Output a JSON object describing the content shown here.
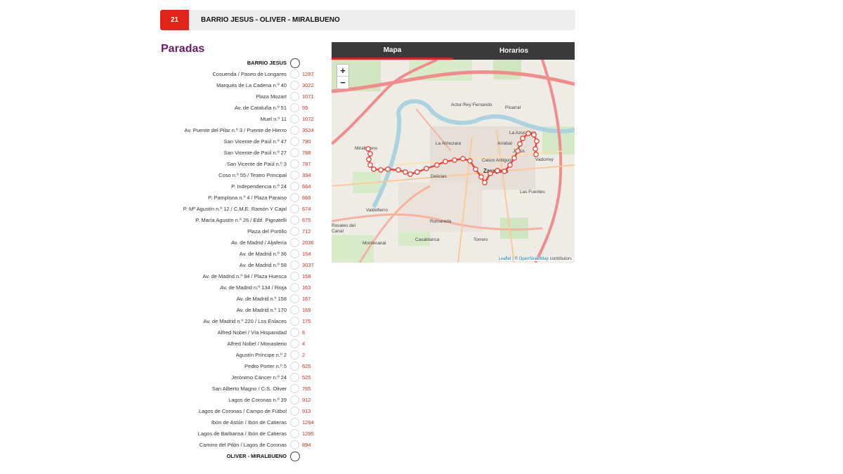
{
  "line": {
    "number": "21",
    "name": "BARRIO JESUS - OLIVER - MIRALBUENO"
  },
  "stops_title": "Paradas",
  "tabs": [
    {
      "label": "Mapa",
      "active": true
    },
    {
      "label": "Horarios",
      "active": false
    }
  ],
  "stops": [
    {
      "name": "BARRIO JESUS",
      "code": "",
      "terminal": true
    },
    {
      "name": "Cosuenda / Paseo de Longares",
      "code": "1297"
    },
    {
      "name": "Marqués de La Cadena n.º 40",
      "code": "3022"
    },
    {
      "name": "Plaza Mozart",
      "code": "1071"
    },
    {
      "name": "Av. de Cataluña n.º 51",
      "code": "55"
    },
    {
      "name": "Muel n.º 11",
      "code": "1072"
    },
    {
      "name": "Av. Puente del Pilar n.º 3 / Puente de Hierro",
      "code": "3524"
    },
    {
      "name": "San Vicente de Paúl n.º 47",
      "code": "790"
    },
    {
      "name": "San Vicente de Paúl n.º 27",
      "code": "788"
    },
    {
      "name": "San Vicente de Paúl n.º 3",
      "code": "787"
    },
    {
      "name": "Coso n.º 55 / Teatro Principal",
      "code": "334"
    },
    {
      "name": "P. Independencia n.º 24",
      "code": "664"
    },
    {
      "name": "P. Pamplona n.º 4 / Plaza Paraiso",
      "code": "669"
    },
    {
      "name": "P. Mª Agustín n.º 12 / C.M.E. Ramón Y Cajal",
      "code": "674"
    },
    {
      "name": "P. María Agustín n.º 26 / Edif. Pignatelli",
      "code": "675"
    },
    {
      "name": "Plaza del Portillo",
      "code": "712"
    },
    {
      "name": "Av. de Madrid / Aljafería",
      "code": "2036"
    },
    {
      "name": "Av. de Madrid n.º 36",
      "code": "154"
    },
    {
      "name": "Av. de Madrid n.º 58",
      "code": "3037"
    },
    {
      "name": "Av. de Madrid n.º 94 / Plaza Huesca",
      "code": "158"
    },
    {
      "name": "Av. de Madrid n.º 134 / Rioja",
      "code": "163"
    },
    {
      "name": "Av. de Madrid n.º 158",
      "code": "167"
    },
    {
      "name": "Av. de Madrid n.º 170",
      "code": "169"
    },
    {
      "name": "Av. de Madrid n.º 220 / Los Enlaces",
      "code": "175"
    },
    {
      "name": "Alfred Nobel / Vía Hispanidad",
      "code": "6"
    },
    {
      "name": "Alfred Nobel / Monasterio",
      "code": "4"
    },
    {
      "name": "Agustín Príncipe n.º 2",
      "code": "2"
    },
    {
      "name": "Pedro Porter n.º 5",
      "code": "625"
    },
    {
      "name": "Jerónimo Cáncer n.º 24",
      "code": "525"
    },
    {
      "name": "San Alberto Magno / C.S. Oliver",
      "code": "765"
    },
    {
      "name": "Lagos de Coronas n.º 39",
      "code": "912"
    },
    {
      "name": "Lagos de Coronas / Campo de Fútbol",
      "code": "913"
    },
    {
      "name": "Ibón de Astún / Ibón de Catieras",
      "code": "1294"
    },
    {
      "name": "Lagos de Barbarisa / Ibón de Catieras",
      "code": "1295"
    },
    {
      "name": "Camino del Pilón / Lagos de Coronas",
      "code": "894"
    },
    {
      "name": "OLIVER - MIRALBUENO",
      "code": "",
      "terminal": true
    }
  ],
  "map": {
    "zoom_in": "+",
    "zoom_out": "−",
    "attribution_leaflet": "Leaflet",
    "attribution_sep": " | © ",
    "attribution_osm": "OpenStreetMap",
    "attribution_tail": " contributors",
    "labels": [
      "Actur-Rey Fernando",
      "Picarral",
      "La Azucarera",
      "La Almozara",
      "Arrabal",
      "Miralbueno",
      "Casco Antiguo",
      "Jesús",
      "Vadorrey",
      "Delicias",
      "Zaragoza",
      "Las Fuentes",
      "Valdefierro",
      "Romareda",
      "Rosales del Canal",
      "Casablanca",
      "Torrero",
      "Montecanal"
    ],
    "route_color": "#e8473a"
  }
}
